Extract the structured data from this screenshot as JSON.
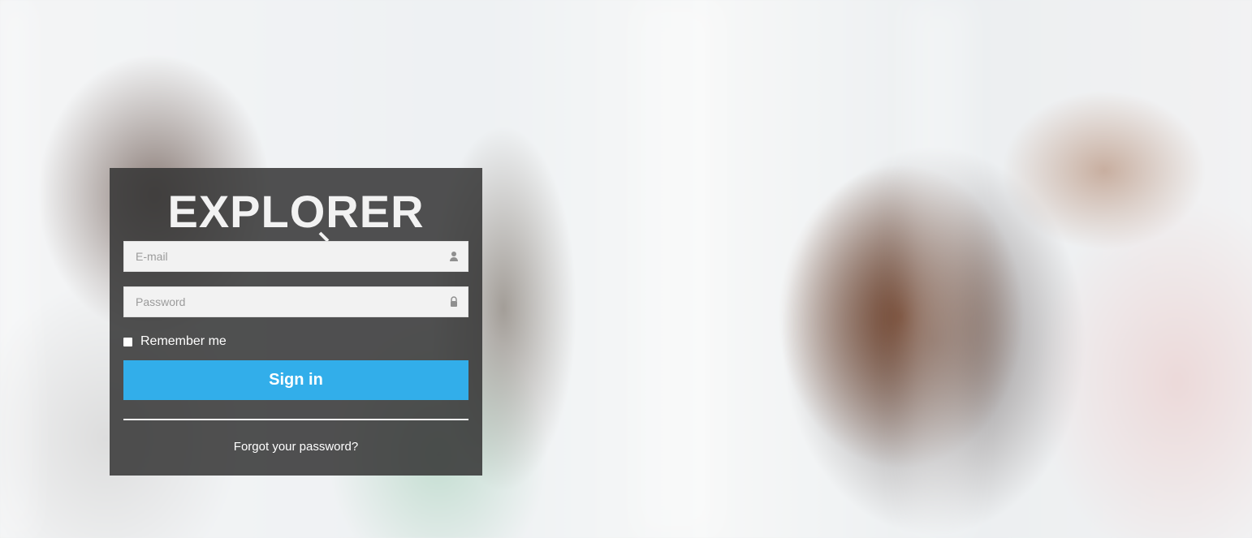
{
  "brand": {
    "name": "EXPLORER"
  },
  "form": {
    "email_placeholder": "E-mail",
    "password_placeholder": "Password",
    "remember_label": "Remember me",
    "sign_in_label": "Sign in",
    "forgot_label": "Forgot your password?"
  },
  "colors": {
    "panel": "#343434",
    "button": "#32aeea",
    "input": "#f2f2f2"
  },
  "icons": {
    "email": "user-icon",
    "password": "lock-icon",
    "logo_mark": "magnifier-icon"
  }
}
